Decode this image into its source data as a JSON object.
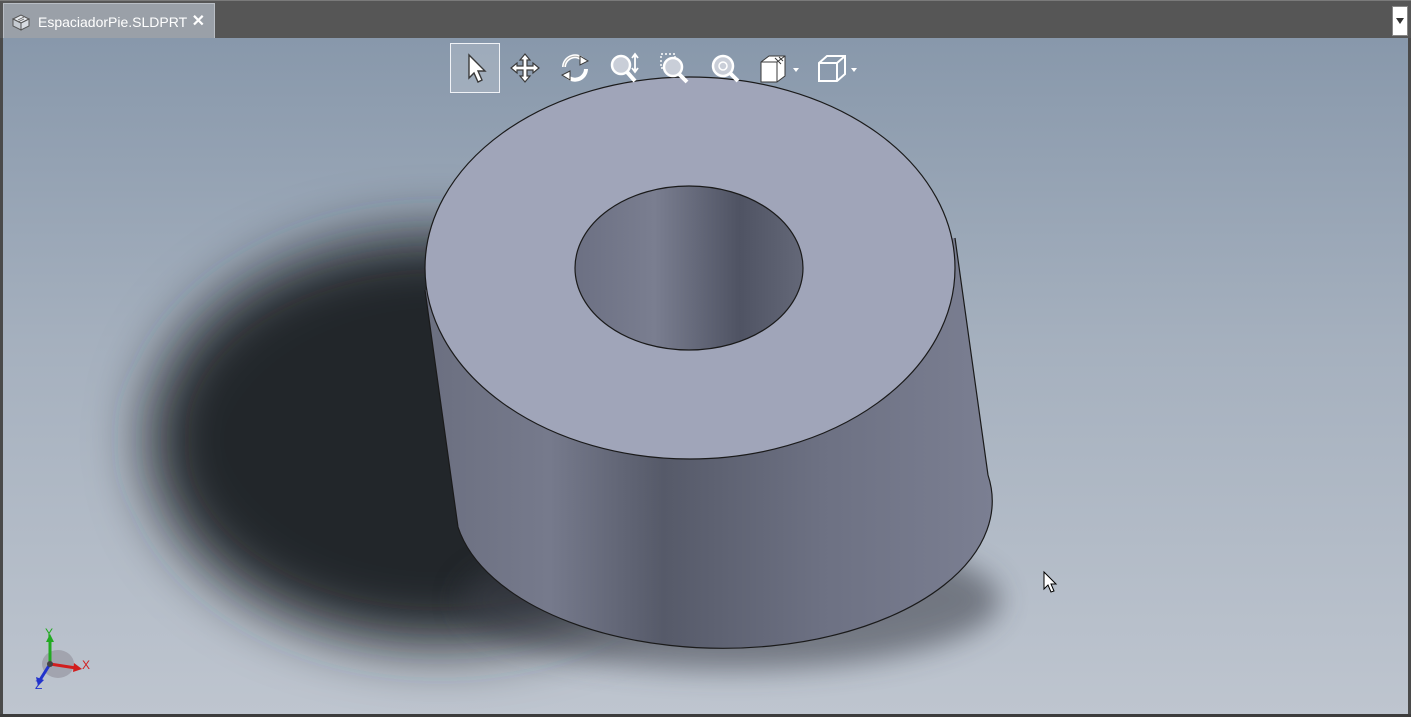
{
  "document_tab": {
    "filename": "EspaciadorPie.SLDPRT",
    "close_glyph": "✕",
    "icon": "part-file-icon"
  },
  "tab_menu": {
    "icon": "chevron-down-icon"
  },
  "view_toolbar": {
    "tools": [
      {
        "id": "select",
        "icon": "select-arrow-icon",
        "active": true
      },
      {
        "id": "pan",
        "icon": "pan-move-icon",
        "active": false
      },
      {
        "id": "rotate",
        "icon": "rotate-view-icon",
        "active": false
      },
      {
        "id": "zoom-in-out",
        "icon": "zoom-in-out-icon",
        "active": false
      },
      {
        "id": "zoom-to-area",
        "icon": "zoom-to-area-icon",
        "active": false
      },
      {
        "id": "zoom-to-fit",
        "icon": "zoom-to-fit-icon",
        "active": false
      },
      {
        "id": "display-style",
        "icon": "display-style-icon",
        "has_dropdown": true
      },
      {
        "id": "view-orientation",
        "icon": "view-orientation-cube-icon",
        "has_dropdown": true
      }
    ]
  },
  "model": {
    "name": "hollow-cylinder-spacer",
    "face_color": "#a0a5b9",
    "side_color": "#6e7283"
  },
  "triad": {
    "x_label": "X",
    "y_label": "Y",
    "z_label": "Z",
    "x_color": "#d21e1e",
    "y_color": "#22aa22",
    "z_color": "#2233cc"
  },
  "colors": {
    "tabbar": "#565656",
    "active_tab": "#9aa0a8",
    "viewport_top": "#8898ab",
    "viewport_bottom": "#bec5cf"
  }
}
